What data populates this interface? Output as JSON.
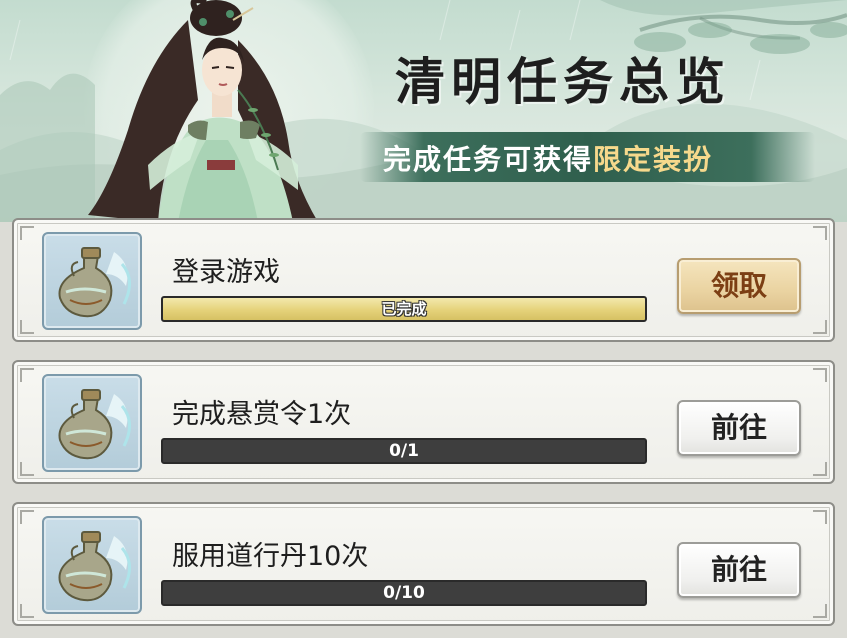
{
  "banner": {
    "title": "清明任务总览",
    "subtitle_plain": "完成任务可获得",
    "subtitle_highlight": "限定装扮",
    "highlight_color": "#f6d98c"
  },
  "tasks": [
    {
      "title": "登录游戏",
      "progress_text": "已完成",
      "progress_fraction": 1.0,
      "button_label": "领取",
      "button_type": "claim",
      "icon": "vase-icon"
    },
    {
      "title": "完成悬赏令1次",
      "progress_text": "0/1",
      "progress_fraction": 0.0,
      "button_label": "前往",
      "button_type": "go",
      "icon": "vase-icon"
    },
    {
      "title": "服用道行丹10次",
      "progress_text": "0/10",
      "progress_fraction": 0.0,
      "button_label": "前往",
      "button_type": "go",
      "icon": "vase-icon"
    }
  ]
}
